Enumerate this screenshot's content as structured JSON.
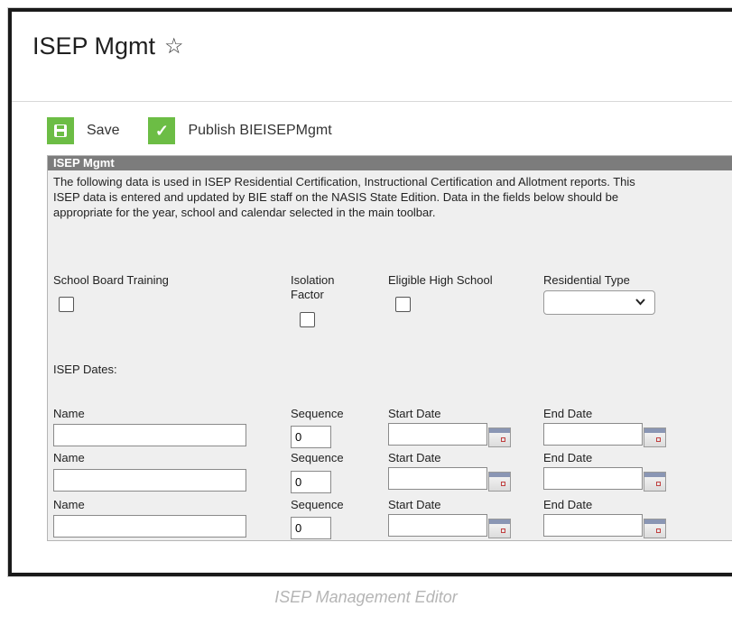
{
  "header": {
    "title": "ISEP Mgmt"
  },
  "toolbar": {
    "save_label": "Save",
    "publish_label": "Publish BIEISEPMgmt"
  },
  "panel": {
    "title": "ISEP Mgmt",
    "description": "The following data is used in ISEP Residential Certification, Instructional Certification and Allotment reports. This ISEP data is entered and updated by BIE staff on the NASIS State Edition. Data in the fields below should be appropriate for the year, school and calendar selected in the main toolbar.",
    "fields": {
      "school_board_training": "School Board Training",
      "isolation_factor": "Isolation Factor",
      "eligible_high_school": "Eligible High School",
      "residential_type": "Residential Type"
    },
    "isep_dates_label": "ISEP Dates:",
    "date_rows": [
      {
        "name_label": "Name",
        "sequence_label": "Sequence",
        "sequence_value": "0",
        "start_label": "Start Date",
        "end_label": "End Date"
      },
      {
        "name_label": "Name",
        "sequence_label": "Sequence",
        "sequence_value": "0",
        "start_label": "Start Date",
        "end_label": "End Date"
      },
      {
        "name_label": "Name",
        "sequence_label": "Sequence",
        "sequence_value": "0",
        "start_label": "Start Date",
        "end_label": "End Date"
      }
    ]
  },
  "caption": "ISEP Management Editor",
  "icons": {
    "save": "save-disk-icon",
    "publish": "checkmark-icon",
    "favorite": "star-outline-icon",
    "calendar": "calendar-icon",
    "dropdown": "chevron-down-icon"
  },
  "colors": {
    "accent_green": "#6cbd45",
    "panel_header": "#7c7c7c",
    "panel_bg": "#efefef"
  }
}
